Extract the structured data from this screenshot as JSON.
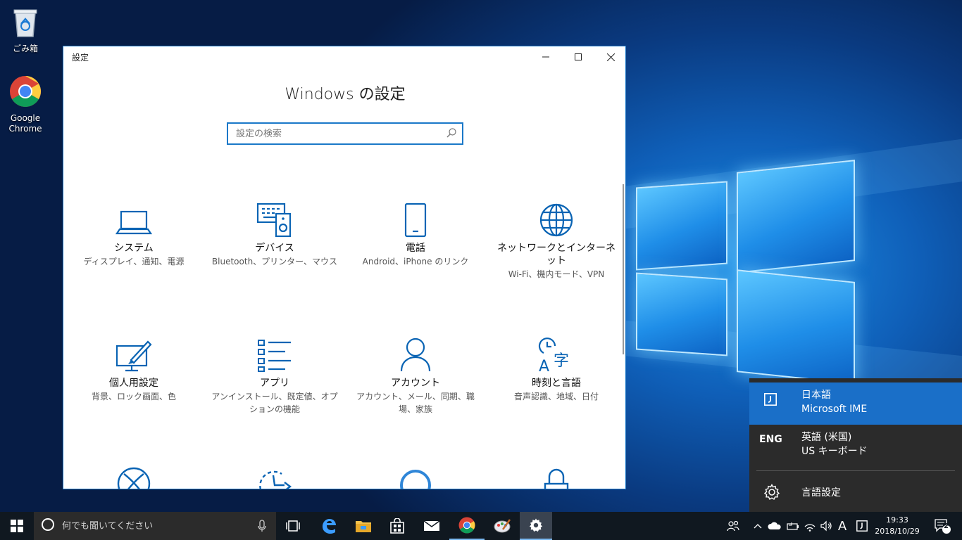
{
  "desktop": {
    "icons": [
      {
        "label": "ごみ箱",
        "icon": "recycle-bin-icon"
      },
      {
        "label": "Google Chrome",
        "icon": "chrome-icon"
      }
    ]
  },
  "window": {
    "title": "設定",
    "heading": "Windows の設定",
    "search_placeholder": "設定の検索",
    "tiles": [
      {
        "name": "システム",
        "desc": "ディスプレイ、通知、電源",
        "icon": "laptop-icon"
      },
      {
        "name": "デバイス",
        "desc": "Bluetooth、プリンター、マウス",
        "icon": "devices-icon"
      },
      {
        "name": "電話",
        "desc": "Android、iPhone のリンク",
        "icon": "phone-icon"
      },
      {
        "name": "ネットワークとインターネット",
        "desc": "Wi-Fi、機内モード、VPN",
        "icon": "globe-icon"
      },
      {
        "name": "個人用設定",
        "desc": "背景、ロック画面、色",
        "icon": "personalization-icon"
      },
      {
        "name": "アプリ",
        "desc": "アンインストール、既定値、オプションの機能",
        "icon": "apps-list-icon"
      },
      {
        "name": "アカウント",
        "desc": "アカウント、メール、同期、職場、家族",
        "icon": "person-icon"
      },
      {
        "name": "時刻と言語",
        "desc": "音声認識、地域、日付",
        "icon": "time-language-icon"
      }
    ]
  },
  "language_flyout": {
    "items": [
      {
        "code_icon": "ime-j-icon",
        "name": "日本語",
        "sub": "Microsoft IME"
      },
      {
        "code": "ENG",
        "name": "英語 (米国)",
        "sub": "US キーボード"
      }
    ],
    "settings_label": "言語設定"
  },
  "taskbar": {
    "search_placeholder": "何でも聞いてください",
    "ime_mode": "A",
    "clock_time": "19:33",
    "clock_date": "2018/10/29",
    "notification_count": "2"
  },
  "colors": {
    "accent": "#1a78c8",
    "tile_icon": "#0a64b4"
  }
}
